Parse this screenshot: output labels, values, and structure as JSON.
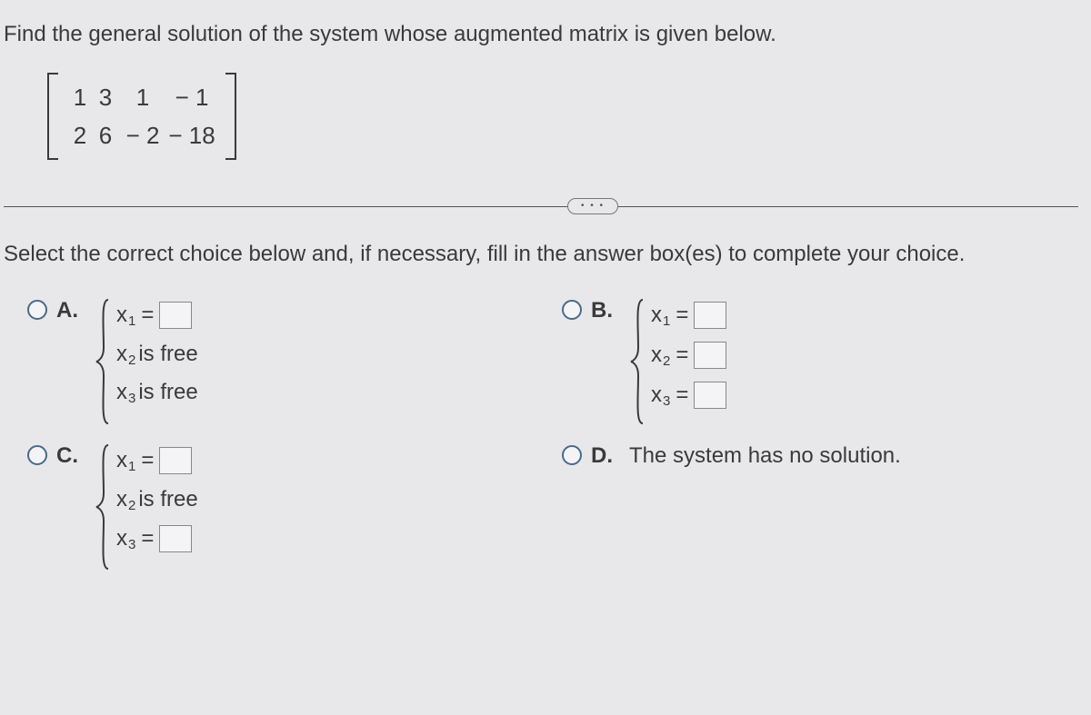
{
  "question": "Find the general solution of the system whose augmented matrix is given below.",
  "matrix": {
    "r1": {
      "a": "1",
      "b": "3",
      "c": "1",
      "d": "− 1"
    },
    "r2": {
      "a": "2",
      "b": "6",
      "c": "− 2",
      "d": "− 18"
    }
  },
  "toggle": "• • •",
  "instruction": "Select the correct choice below and, if necessary, fill in the answer box(es) to complete your choice.",
  "labels": {
    "A": "A.",
    "B": "B.",
    "C": "C.",
    "D": "D."
  },
  "vars": {
    "x": "x",
    "eq": "="
  },
  "text": {
    "is_free": " is free",
    "no_solution": "The system has no solution."
  }
}
